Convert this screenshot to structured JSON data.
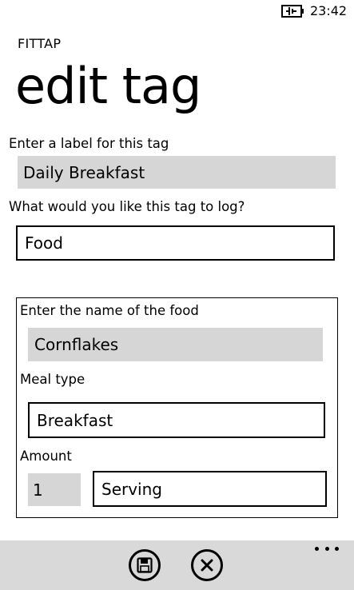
{
  "status_bar": {
    "time": "23:42",
    "battery_icon": "battery-charging-icon"
  },
  "header": {
    "app_name": "FITTAP",
    "page_title": "edit tag"
  },
  "form": {
    "label_prompt": "Enter a label for this tag",
    "label_value": "Daily Breakfast",
    "log_prompt": "What would you like this tag to log?",
    "log_value": "Food"
  },
  "food_panel": {
    "name_prompt": "Enter the name of the food",
    "name_value": "Cornflakes",
    "meal_prompt": "Meal type",
    "meal_value": "Breakfast",
    "amount_prompt": "Amount",
    "amount_value": "1",
    "unit_value": "Serving"
  },
  "app_bar": {
    "buttons": [
      "save-icon",
      "cancel-icon"
    ],
    "more_icon": "ellipsis-icon"
  },
  "colors": {
    "field_fill": "#d6d6d6",
    "app_bar": "#d9d9d9",
    "text": "#000000"
  }
}
